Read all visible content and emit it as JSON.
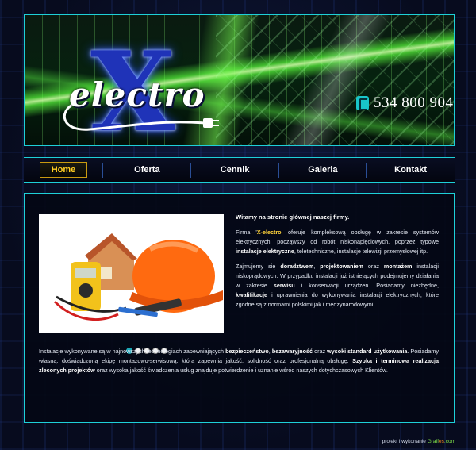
{
  "header": {
    "logo_letter": "X",
    "logo_word": "electro",
    "phone": "534 800 904"
  },
  "nav": {
    "items": [
      {
        "label": "Home",
        "active": true
      },
      {
        "label": "Oferta",
        "active": false
      },
      {
        "label": "Cennik",
        "active": false
      },
      {
        "label": "Galeria",
        "active": false
      },
      {
        "label": "Kontakt",
        "active": false
      }
    ]
  },
  "slider": {
    "slides": 5,
    "active_index": 0
  },
  "content": {
    "welcome": "Witamy na stronie głównej naszej firmy.",
    "p1": {
      "a": "Firma '",
      "brand": "X-electro",
      "b": "' oferuje kompleksową obsługę w zakresie systemów elektrycznych, począwszy od robót niskonapięciowych, poprzez typowe ",
      "bold": "instalacje elektryczne",
      "c": ", teletechniczne, instalacje telewizji przemysłowej itp."
    },
    "p2": {
      "a": "Zajmujemy się ",
      "b1": "doradztwem",
      "c": ", ",
      "b2": "projektowaniem",
      "d": " oraz ",
      "b3": "montażem",
      "e": " instalacji niskoprądowych. W przypadku instalacji już istniejących podejmujemy działania w zakresie ",
      "b4": "serwisu",
      "f": " i konserwacji urządzeń. Posiadamy niezbędne, ",
      "b5": "kwalifikacje",
      "g": " i uprawnienia do wykonywania instalacji elektrycznych, które zgodne są z normami polskimi jak i mędzynarodowymi."
    },
    "p3": {
      "a": "Instalacje wykonywane są w najnowszych technologiach zapewniających ",
      "b1": "bezpieczeństwo",
      "c": ", ",
      "b2": "bezawaryjność",
      "d": " oraz ",
      "b3": "wysoki standard użytkowania",
      "e": ". Posiadamy własną, doświadczoną ekipę montażowo-serwisową, która zapewnia jakość, solidność oraz profesjonalną obsługę. ",
      "b4": "Szybka i terminowa realizacja zleconych projektów",
      "f": " oraz wysoka jakość świadczenia usług znajduje potwierdzenie i uznanie wśród naszych dotychczasowych Klientów."
    }
  },
  "footer": {
    "text": "projekt i wykonanie ",
    "brand_a": "Graff",
    "brand_b": "es",
    "brand_c": ".com"
  },
  "colors": {
    "accent_cyan": "#1ed0d8",
    "active_nav": "#ffcc22",
    "brand_highlight": "#ffd33a"
  }
}
